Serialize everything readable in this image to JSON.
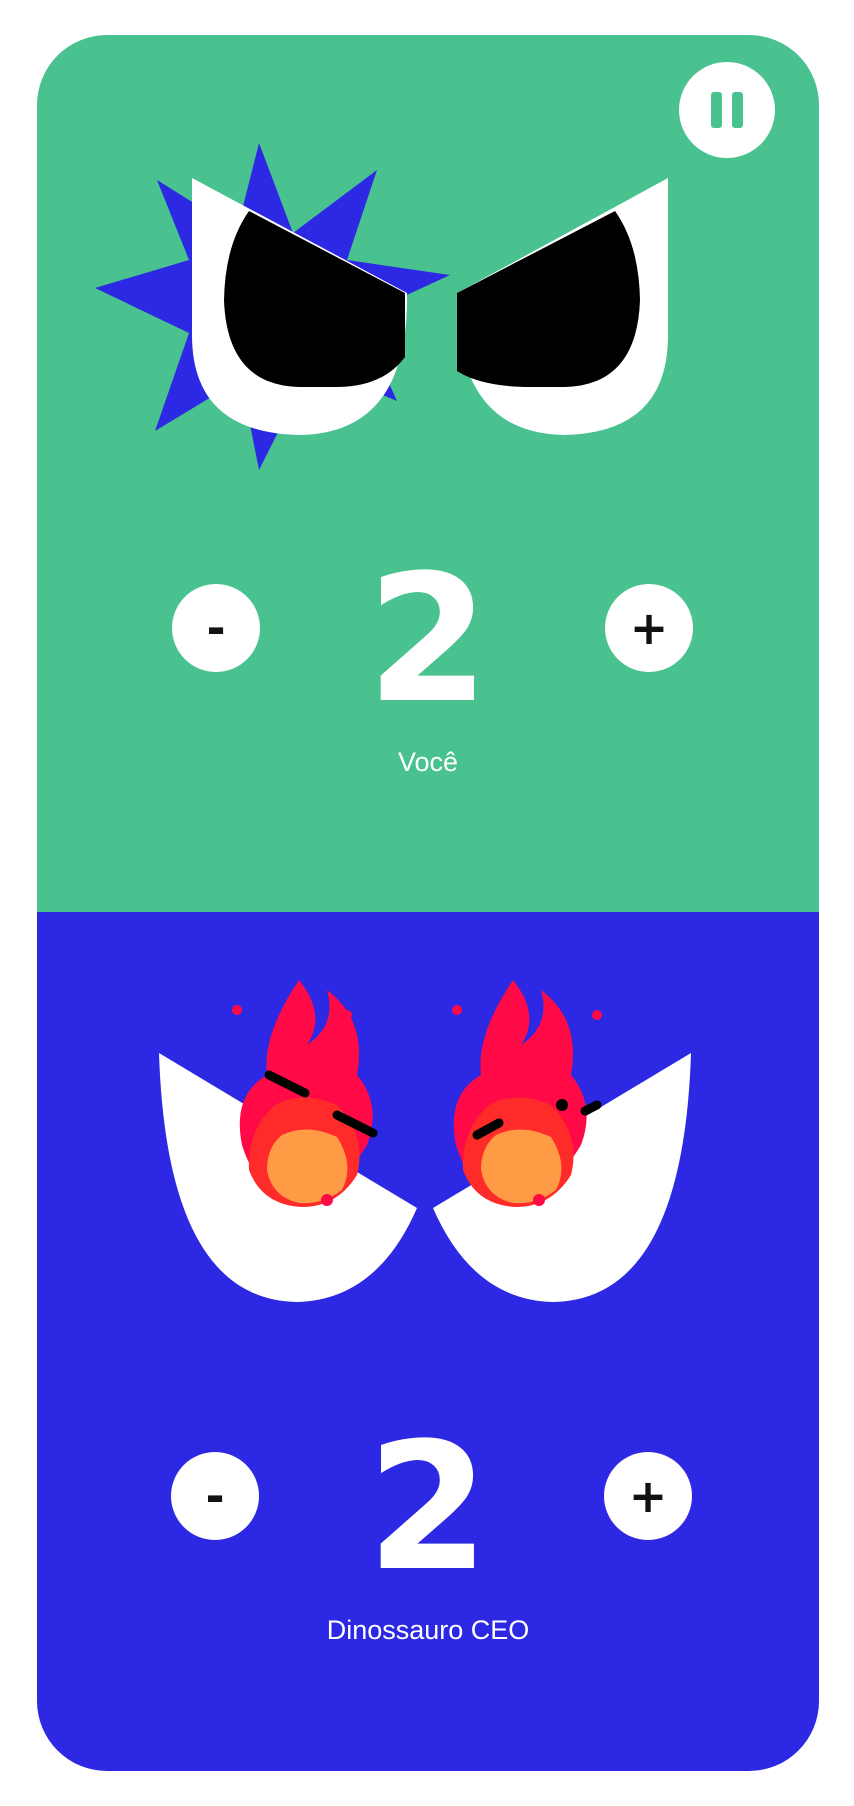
{
  "colors": {
    "top_bg": "#49c28f",
    "bottom_bg": "#2d28e3",
    "burst": "#2d28e3",
    "eye_white": "#ffffff",
    "pupil": "#000000"
  },
  "controls": {
    "pause_icon": "pause-icon"
  },
  "players": [
    {
      "id": "top",
      "name": "Você",
      "score": "2",
      "minus_label": "-",
      "plus_label": "+",
      "expression": "angry-eyes"
    },
    {
      "id": "bottom",
      "name": "Dinossauro CEO",
      "score": "2",
      "minus_label": "-",
      "plus_label": "+",
      "expression": "fire-eyes"
    }
  ]
}
